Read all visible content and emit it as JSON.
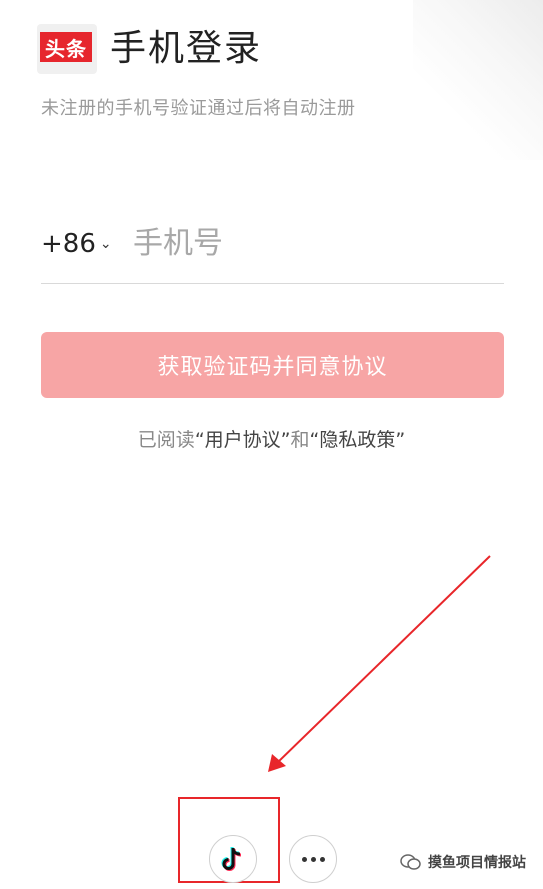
{
  "app_logo": {
    "text": "头条",
    "color": "#e6262d"
  },
  "header": {
    "title": "手机登录",
    "subtitle": "未注册的手机号验证通过后将自动注册"
  },
  "phone": {
    "country_code": "+86",
    "placeholder": "手机号",
    "value": ""
  },
  "actions": {
    "get_code_label": "获取验证码并同意协议",
    "button_color": "#f7a5a5"
  },
  "agreement": {
    "prefix": "已阅读",
    "user_agreement": "“用户协议”",
    "conjunction": "和",
    "privacy_policy": "“隐私政策”"
  },
  "third_party_login": [
    {
      "name": "douyin",
      "icon": "douyin-icon"
    },
    {
      "name": "more",
      "icon": "more-dots-icon"
    }
  ],
  "annotation": {
    "color": "#e8262a"
  },
  "watermark": {
    "text": "摸鱼项目情报站",
    "icon": "wechat-official-account-icon"
  }
}
